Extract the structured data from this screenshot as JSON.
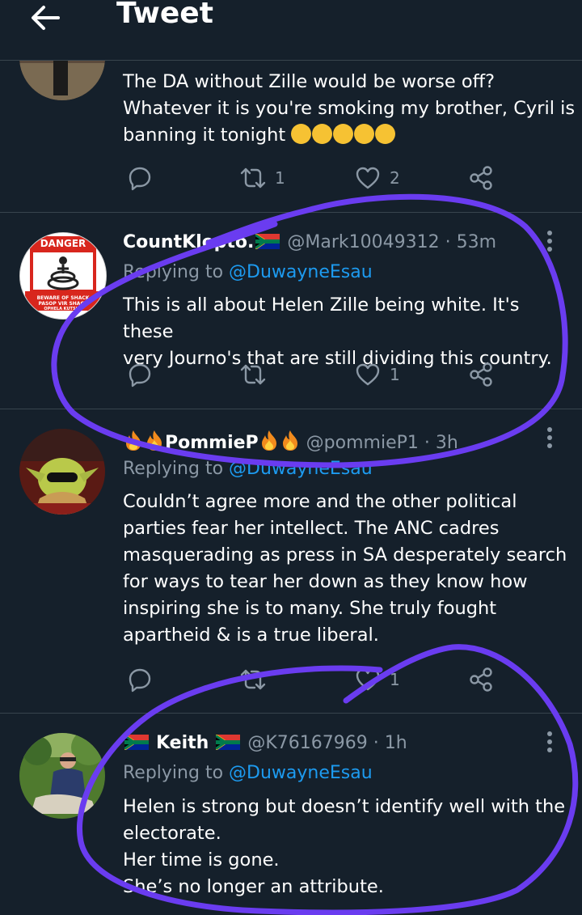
{
  "header": {
    "title": "Tweet"
  },
  "tweets": [
    {
      "text_lines": [
        "The DA without Zille would be worse off?",
        "Whatever it is you're smoking my brother, Cyril is",
        "banning it tonight"
      ],
      "emoji": "🤣🤣🤣🤣🤣",
      "retweet_count": "1",
      "like_count": "2"
    },
    {
      "display_name": "CountKlepto.",
      "flag": "🇿🇦",
      "handle": "@Mark10049312",
      "time": "· 53m",
      "replying_prefix": "Replying to",
      "replying_to": "@DuwayneEsau",
      "text_lines": [
        "This is all about Helen Zille being white. It's these",
        "very Journo's that are still dividing this country."
      ],
      "avatar_text_top": "DANGER",
      "avatar_text_bottom": "BEWARE OF SHACK PASOP VIR SHACK OPHELA KUTSHA",
      "retweet_count": "",
      "like_count": "1"
    },
    {
      "display_name": "PommieP",
      "handle": "@pommieP1",
      "time": "· 3h",
      "replying_prefix": "Replying to",
      "replying_to": "@DuwayneEsau",
      "text_lines": [
        "Couldn’t agree more and the other political",
        "parties fear her intellect. The ANC cadres",
        "masquerading as press in SA desperately search",
        "for ways to tear her down as they know how",
        "inspiring she is to many. She truly fought",
        "apartheid & is a true liberal."
      ],
      "retweet_count": "",
      "like_count": "1"
    },
    {
      "display_name": "Keith",
      "handle": "@K76167969",
      "time": "· 1h",
      "replying_prefix": "Replying to",
      "replying_to": "@DuwayneEsau",
      "text_lines": [
        "Helen is strong but doesn’t identify well with the",
        "electorate.",
        "Her time is gone.",
        "She’s no longer an attribute."
      ]
    }
  ],
  "colors": {
    "background": "#15202b",
    "secondary_text": "#8b98a5",
    "link": "#1d9bf0",
    "divider": "#38444d",
    "annotation": "#6a3cf0"
  },
  "icons": [
    "back-arrow-icon",
    "reply-icon",
    "retweet-icon",
    "like-icon",
    "share-icon",
    "more-icon"
  ]
}
